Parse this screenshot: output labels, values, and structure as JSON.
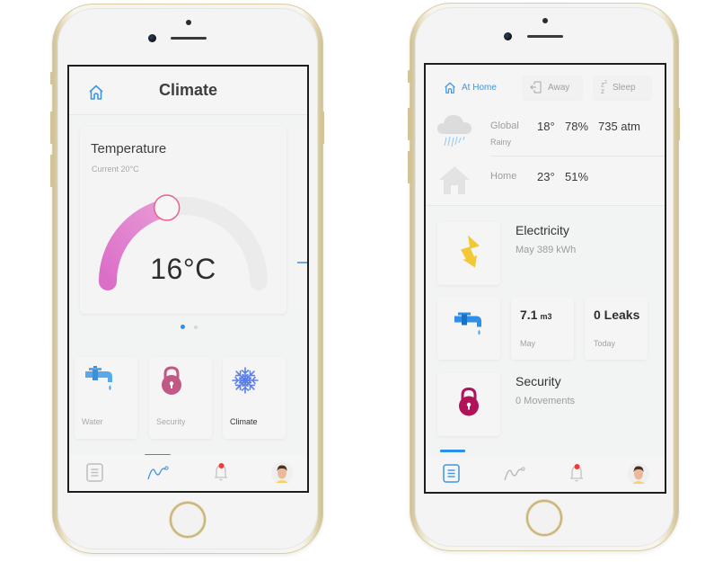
{
  "phones": [
    {
      "screen": "climate",
      "header": {
        "home_icon": "home-outline-icon",
        "title": "Climate"
      },
      "temperature_card": {
        "title": "Temperature",
        "current_label": "Current 20°C",
        "setpoint_display": "16°C",
        "dial_fill_fraction": 0.43
      },
      "pager": {
        "pages": 2,
        "active_index": 0
      },
      "device_tiles": [
        {
          "label": "Water",
          "icon": "water-faucet-icon",
          "active": false
        },
        {
          "label": "Security",
          "icon": "padlock-icon",
          "active": false
        },
        {
          "label": "Climate",
          "icon": "snowflake-icon",
          "active": true
        }
      ],
      "tabbar": {
        "active_index": 1,
        "tabs": [
          {
            "icon": "list-document-icon"
          },
          {
            "icon": "chart-line-icon"
          },
          {
            "icon": "bell-notification-icon",
            "has_badge": true
          },
          {
            "icon": "user-avatar-icon"
          }
        ]
      }
    },
    {
      "screen": "dashboard",
      "modes": [
        {
          "label": "At Home",
          "icon": "home-outline-icon",
          "active": true
        },
        {
          "label": "Away",
          "icon": "exit-door-icon",
          "active": false
        },
        {
          "label": "Sleep",
          "icon": "sleep-zzz-icon",
          "active": false
        }
      ],
      "weather": {
        "global": {
          "label": "Global",
          "condition": "Rainy",
          "temperature": "18°",
          "humidity": "78%",
          "pressure": "735 atm",
          "icon": "rain-cloud-icon"
        },
        "home": {
          "label": "Home",
          "temperature": "23°",
          "humidity": "51%",
          "icon": "house-icon"
        }
      },
      "electricity": {
        "title": "Electricity",
        "subtitle": "May 389 kWh",
        "icon": "lightning-bolt-icon"
      },
      "water": {
        "icon": "water-faucet-icon",
        "usage_value": "7.1",
        "usage_unit": "m3",
        "usage_period": "May",
        "leaks_value": "0 Leaks",
        "leaks_period": "Today"
      },
      "security": {
        "title": "Security",
        "subtitle": "0 Movements",
        "icon": "padlock-icon"
      },
      "tabbar": {
        "active_index": 0,
        "tabs": [
          {
            "icon": "list-document-icon"
          },
          {
            "icon": "chart-line-icon"
          },
          {
            "icon": "bell-notification-icon",
            "has_badge": true
          },
          {
            "icon": "user-avatar-icon"
          }
        ]
      }
    }
  ],
  "colors": {
    "accent_blue": "#2e8fe8",
    "dial_pink": "#dd7fd0",
    "dial_track": "#e9e9e9",
    "bolt_yellow": "#f2c935",
    "lock_crimson": "#b0135a",
    "lock_rose": "#c05a85",
    "snow_blue": "#5b7fe6",
    "badge_red": "#f03b3b",
    "frame_gold": "#cdbf92"
  }
}
